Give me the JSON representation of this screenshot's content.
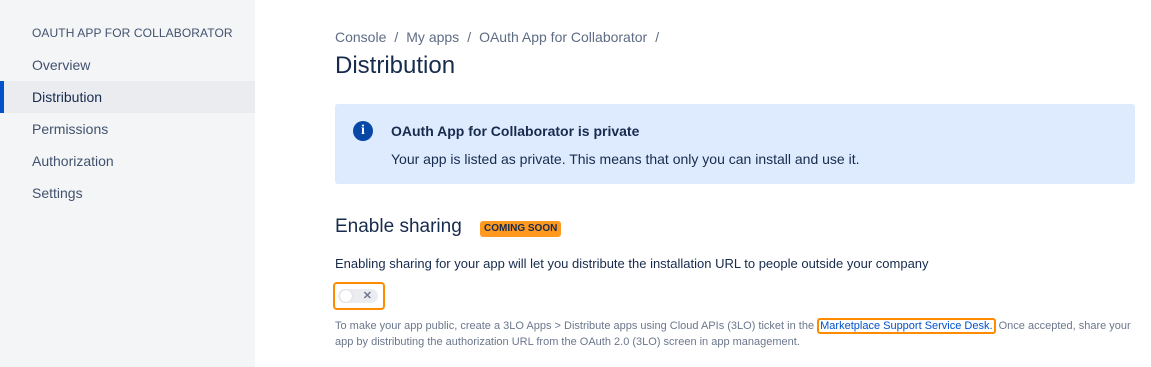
{
  "sidebar": {
    "title": "OAUTH APP FOR COLLABORATOR",
    "items": [
      {
        "label": "Overview"
      },
      {
        "label": "Distribution"
      },
      {
        "label": "Permissions"
      },
      {
        "label": "Authorization"
      },
      {
        "label": "Settings"
      }
    ],
    "active": "Distribution"
  },
  "breadcrumb": [
    "Console",
    "My apps",
    "OAuth App for Collaborator"
  ],
  "page_title": "Distribution",
  "banner": {
    "icon": "info-icon",
    "heading": "OAuth App for Collaborator is private",
    "text": "Your app is listed as private. This means that only you can install and use it."
  },
  "sharing": {
    "title": "Enable sharing",
    "badge": "COMING SOON",
    "description": "Enabling sharing for your app will let you distribute the installation URL to people outside your company",
    "toggle_on": false,
    "help_prefix": "To make your app public, create a 3LO Apps > Distribute apps using Cloud APIs (3LO) ticket in the",
    "help_link": "Marketplace Support Service Desk.",
    "help_suffix": " Once accepted, share your app by distributing the authorization URL from the OAuth 2.0 (3LO) screen in app management."
  },
  "colors": {
    "accent": "#0052cc",
    "badge": "#ff991f",
    "focus": "#ff8b00",
    "banner_bg": "#deebff"
  }
}
